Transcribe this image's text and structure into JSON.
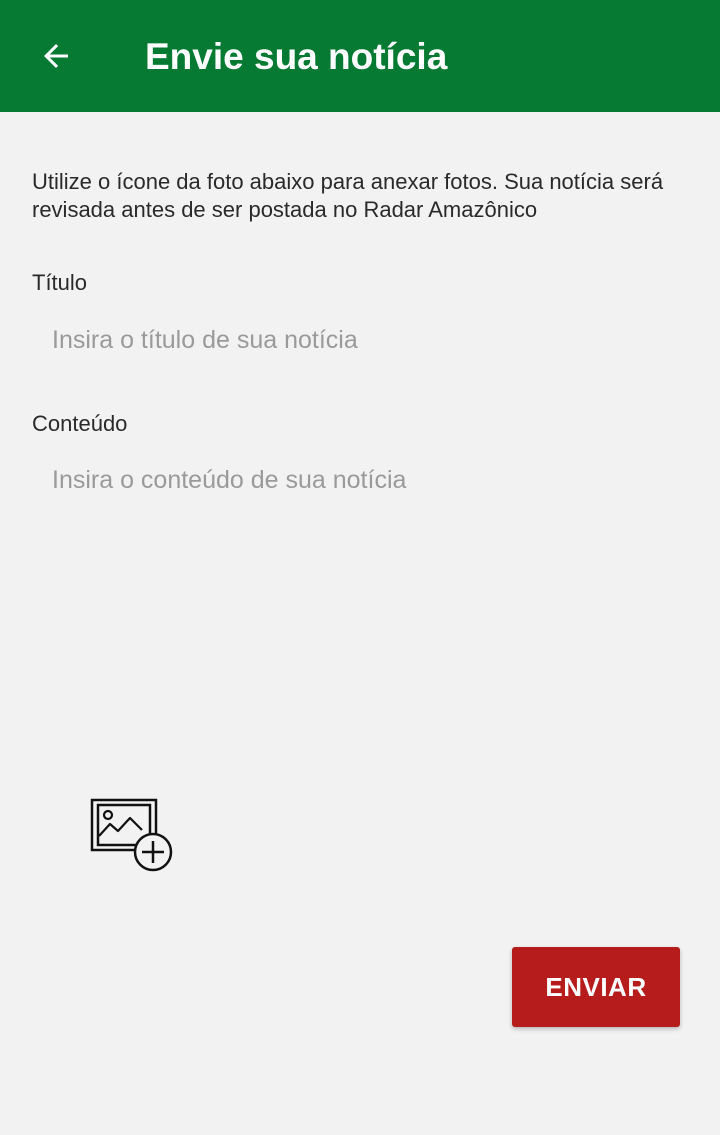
{
  "app_bar": {
    "title": "Envie sua notícia",
    "back_icon": "arrow-left-icon",
    "background_color": "#067a33"
  },
  "intro": {
    "text": "Utilize o ícone da foto abaixo para anexar fotos. Sua notícia será revisada antes de ser postada no Radar Amazônico"
  },
  "form": {
    "title_label": "Título",
    "title_placeholder": "Insira o título de sua notícia",
    "title_value": "",
    "content_label": "Conteúdo",
    "content_placeholder": "Insira o conteúdo de sua notícia",
    "content_value": ""
  },
  "attach": {
    "icon": "add-photo-icon"
  },
  "actions": {
    "send_label": "ENVIAR",
    "send_color": "#b71c1c"
  }
}
